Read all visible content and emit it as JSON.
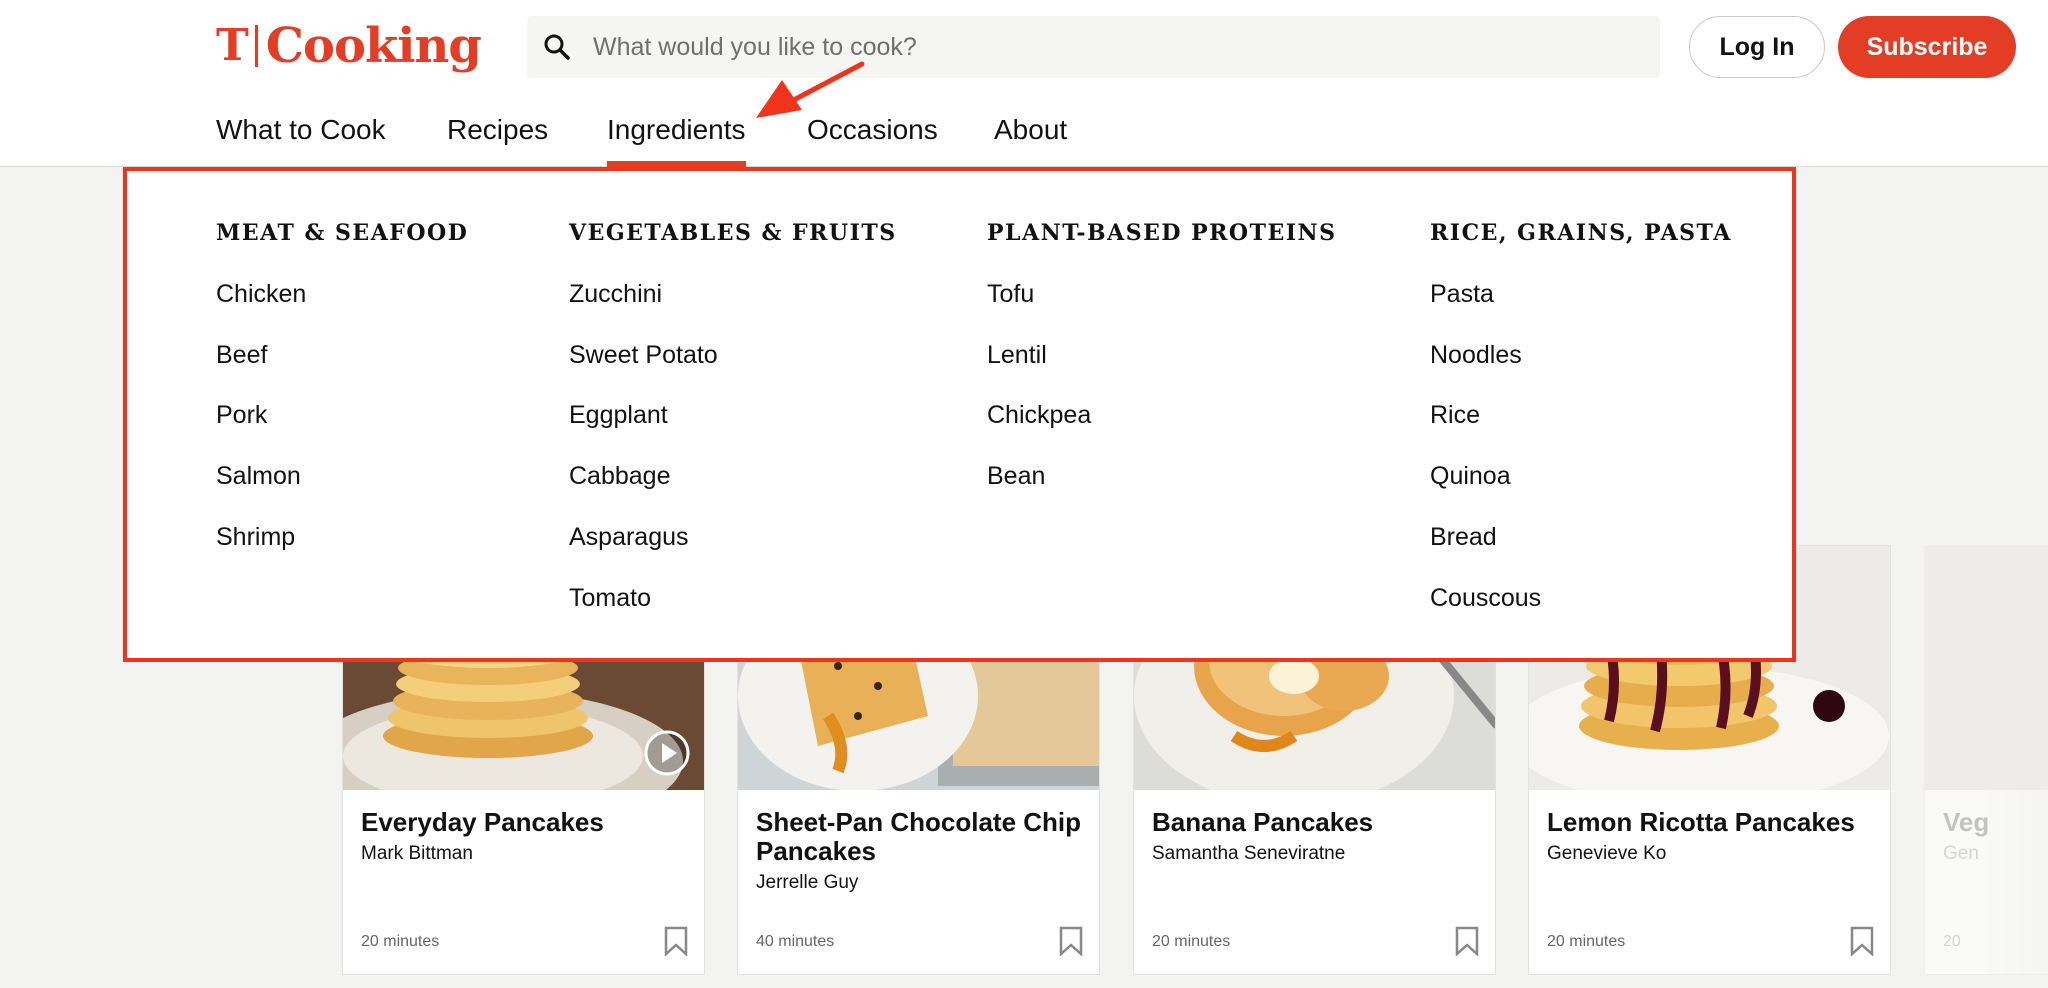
{
  "header": {
    "logo_mark": "T",
    "logo_word": "Cooking",
    "search_placeholder": "What would you like to cook?",
    "login_label": "Log In",
    "subscribe_label": "Subscribe"
  },
  "nav": {
    "items": [
      {
        "label": "What to Cook"
      },
      {
        "label": "Recipes"
      },
      {
        "label": "Ingredients",
        "active": true
      },
      {
        "label": "Occasions"
      },
      {
        "label": "About"
      }
    ]
  },
  "dropdown": {
    "columns": [
      {
        "heading": "MEAT & SEAFOOD",
        "items": [
          "Chicken",
          "Beef",
          "Pork",
          "Salmon",
          "Shrimp"
        ]
      },
      {
        "heading": "VEGETABLES & FRUITS",
        "items": [
          "Zucchini",
          "Sweet Potato",
          "Eggplant",
          "Cabbage",
          "Asparagus",
          "Tomato"
        ]
      },
      {
        "heading": "PLANT-BASED PROTEINS",
        "items": [
          "Tofu",
          "Lentil",
          "Chickpea",
          "Bean"
        ]
      },
      {
        "heading": "RICE, GRAINS, PASTA",
        "items": [
          "Pasta",
          "Noodles",
          "Rice",
          "Quinoa",
          "Bread",
          "Couscous"
        ]
      }
    ]
  },
  "cards": [
    {
      "title": "Everyday Pancakes",
      "author": "Mark Bittman",
      "time": "20 minutes",
      "has_video": true
    },
    {
      "title": "Sheet-Pan Chocolate Chip Pancakes",
      "author": "Jerrelle Guy",
      "time": "40 minutes"
    },
    {
      "title": "Banana Pancakes",
      "author": "Samantha Seneviratne",
      "time": "20 minutes"
    },
    {
      "title": "Lemon Ricotta Pancakes",
      "author": "Genevieve Ko",
      "time": "20 minutes"
    }
  ],
  "partial_card": {
    "title": "Veg",
    "author": "Gen",
    "time": "20"
  },
  "colors": {
    "brand": "#e33d26",
    "highlight_box": "#f0341c"
  }
}
